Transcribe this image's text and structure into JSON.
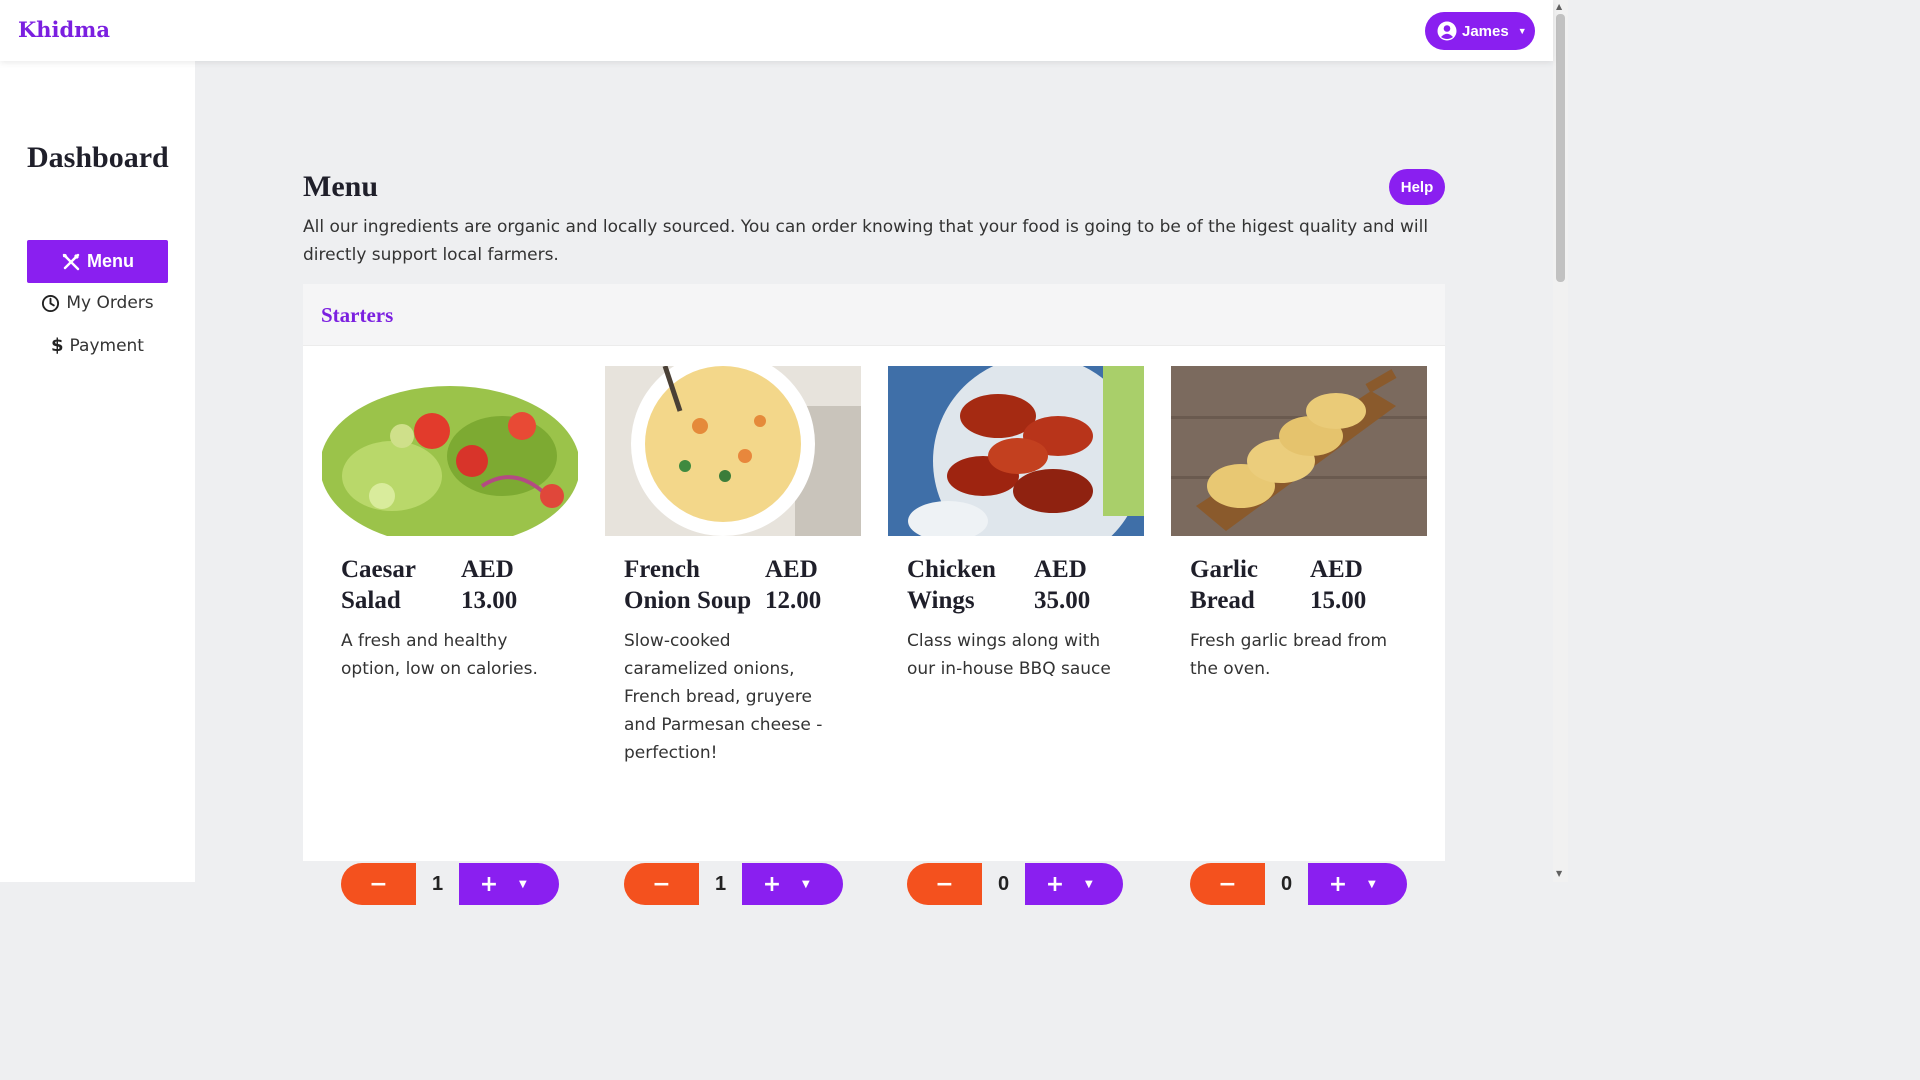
{
  "brand": "Khidma",
  "user": {
    "name": "James",
    "icon": "user-circle-icon"
  },
  "sidebar": {
    "title": "Dashboard",
    "items": [
      {
        "label": "Menu",
        "icon": "utensils-icon",
        "active": true
      },
      {
        "label": "My Orders",
        "icon": "clock-icon",
        "active": false
      },
      {
        "label": "Payment",
        "icon": "dollar-icon",
        "active": false
      }
    ]
  },
  "main": {
    "title": "Menu",
    "help_label": "Help",
    "description": "All our ingredients are organic and locally sourced. You can order knowing that your food is going to be of the higest quality and will directly support local farmers.",
    "section": {
      "title": "Starters",
      "items": [
        {
          "name": "Caesar Salad",
          "price_currency": "AED",
          "price": "13.00",
          "description": "A fresh and healthy option, low on calories.",
          "quantity": "1"
        },
        {
          "name": "French Onion Soup",
          "price_currency": "AED",
          "price": "12.00",
          "description": "Slow-cooked caramelized onions, French bread, gruyere and Parmesan cheese - perfection!",
          "quantity": "1"
        },
        {
          "name": "Chicken Wings",
          "price_currency": "AED",
          "price": "35.00",
          "description": "Class wings along with our in-house BBQ sauce",
          "quantity": "0"
        },
        {
          "name": "Garlic Bread",
          "price_currency": "AED",
          "price": "15.00",
          "description": "Fresh garlic bread from the oven.",
          "quantity": "0"
        }
      ]
    }
  },
  "colors": {
    "accent": "#8a1ff0",
    "minus": "#f4511e",
    "brand": "#7b1fe0"
  }
}
